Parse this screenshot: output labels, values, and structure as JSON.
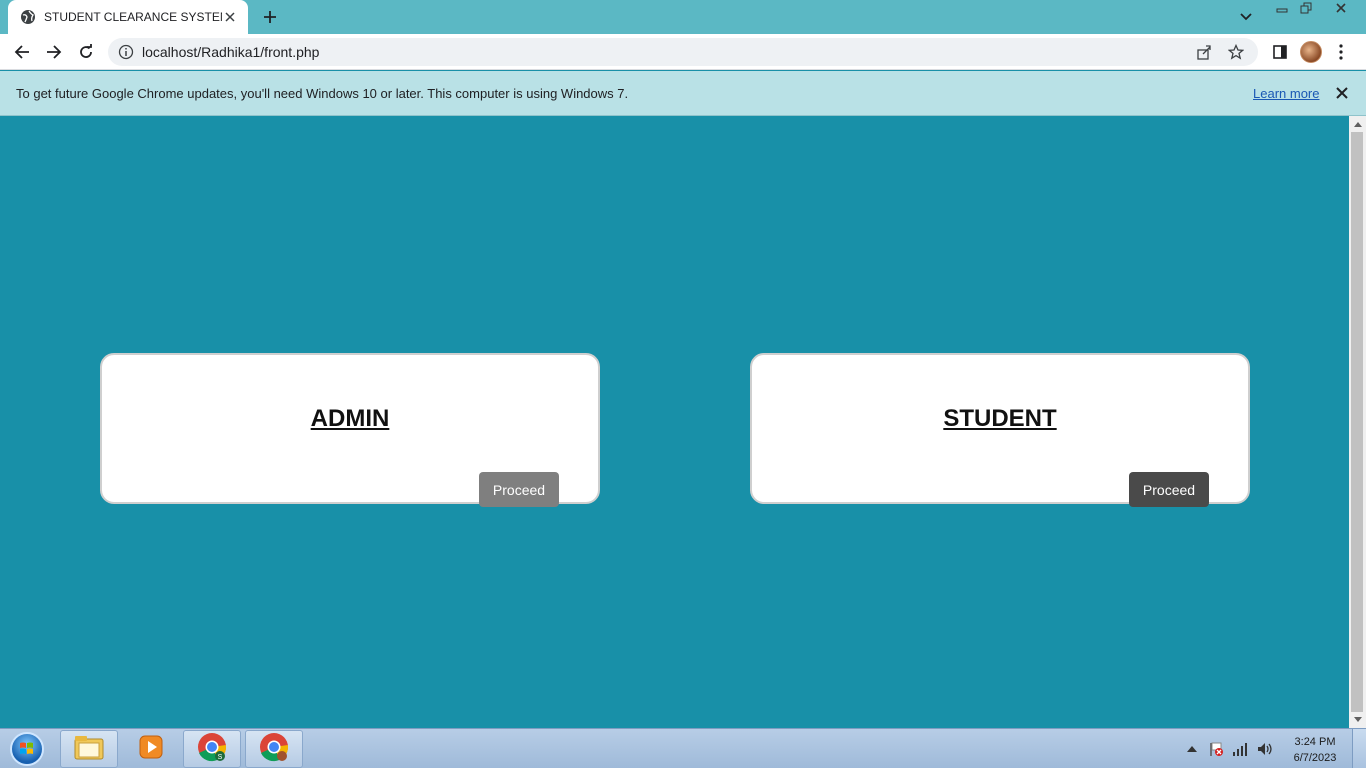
{
  "browser": {
    "tab": {
      "title": "STUDENT CLEARANCE SYSTEM",
      "favicon": "globe-icon"
    },
    "url": "localhost/Radhika1/front.php",
    "infobar": {
      "message": "To get future Google Chrome updates, you'll need Windows 10 or later. This computer is using Windows 7.",
      "link": "Learn more"
    }
  },
  "page": {
    "background_color": "#1890a8",
    "cards": [
      {
        "title": "ADMIN",
        "button": "Proceed",
        "button_color": "#7f7f7f"
      },
      {
        "title": "STUDENT",
        "button": "Proceed",
        "button_color": "#4a4a4a"
      }
    ]
  },
  "taskbar": {
    "apps": [
      "windows-explorer-icon",
      "media-player-icon",
      "chrome-icon",
      "chrome-icon"
    ],
    "clock": {
      "time": "3:24 PM",
      "date": "6/7/2023"
    }
  }
}
